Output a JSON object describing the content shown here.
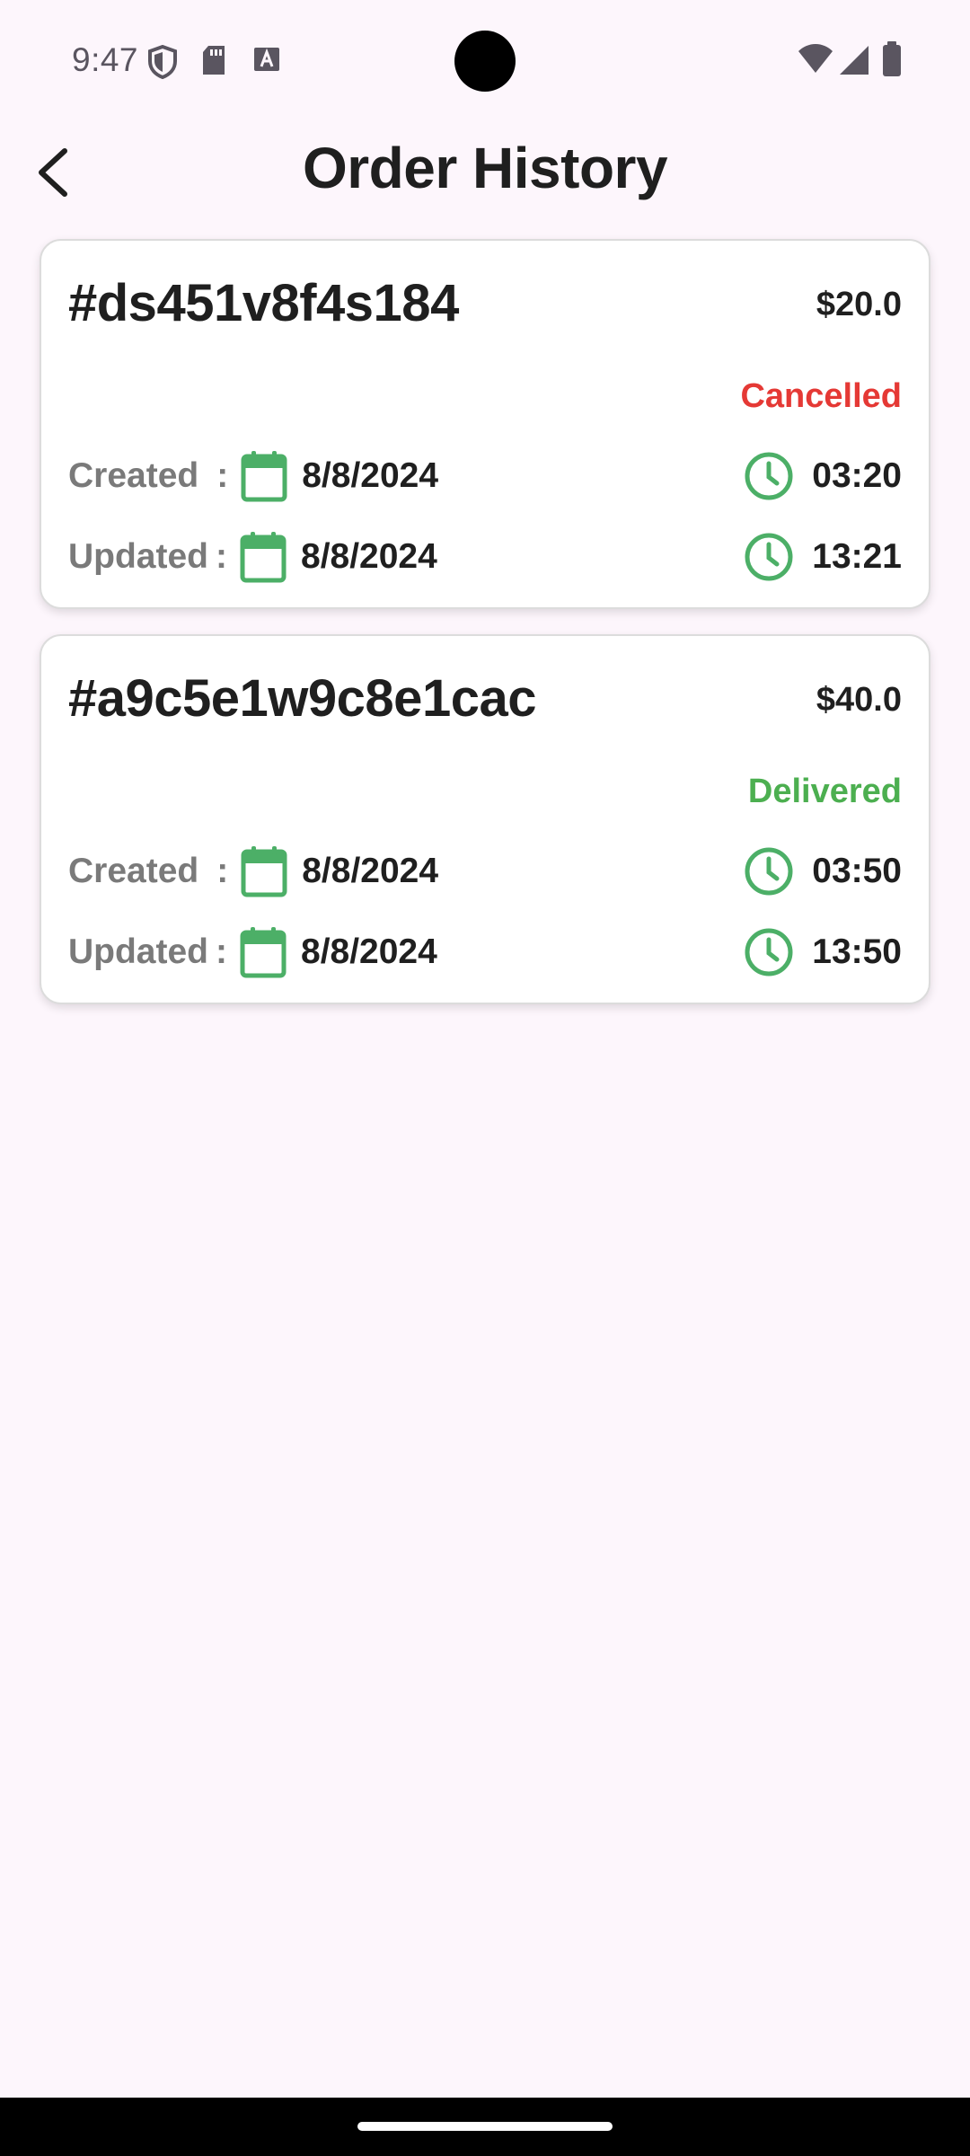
{
  "status_bar": {
    "time": "9:47",
    "left_icons": [
      "shield-icon",
      "sd-card-icon",
      "text-a-icon"
    ],
    "right_icons": [
      "wifi-icon",
      "signal-icon",
      "battery-icon"
    ]
  },
  "header": {
    "title": "Order History",
    "back_icon": "arrow-back-icon"
  },
  "colors": {
    "background": "#fdf6fc",
    "accent_green": "#4caf67",
    "cancelled": "#e53935",
    "delivered": "#4caf50"
  },
  "orders": [
    {
      "id": "#ds451v8f4s184",
      "amount": "$20.0",
      "status": "Cancelled",
      "status_color": "#e53935",
      "created_label": "Created",
      "created_date": "8/8/2024",
      "created_time": "03:20",
      "updated_label": "Updated",
      "updated_date": "8/8/2024",
      "updated_time": "13:21"
    },
    {
      "id": "#a9c5e1w9c8e1cac",
      "amount": "$40.0",
      "status": "Delivered",
      "status_color": "#4caf50",
      "created_label": "Created",
      "created_date": "8/8/2024",
      "created_time": "03:50",
      "updated_label": "Updated",
      "updated_date": "8/8/2024",
      "updated_time": "13:50"
    }
  ],
  "colon": ":"
}
